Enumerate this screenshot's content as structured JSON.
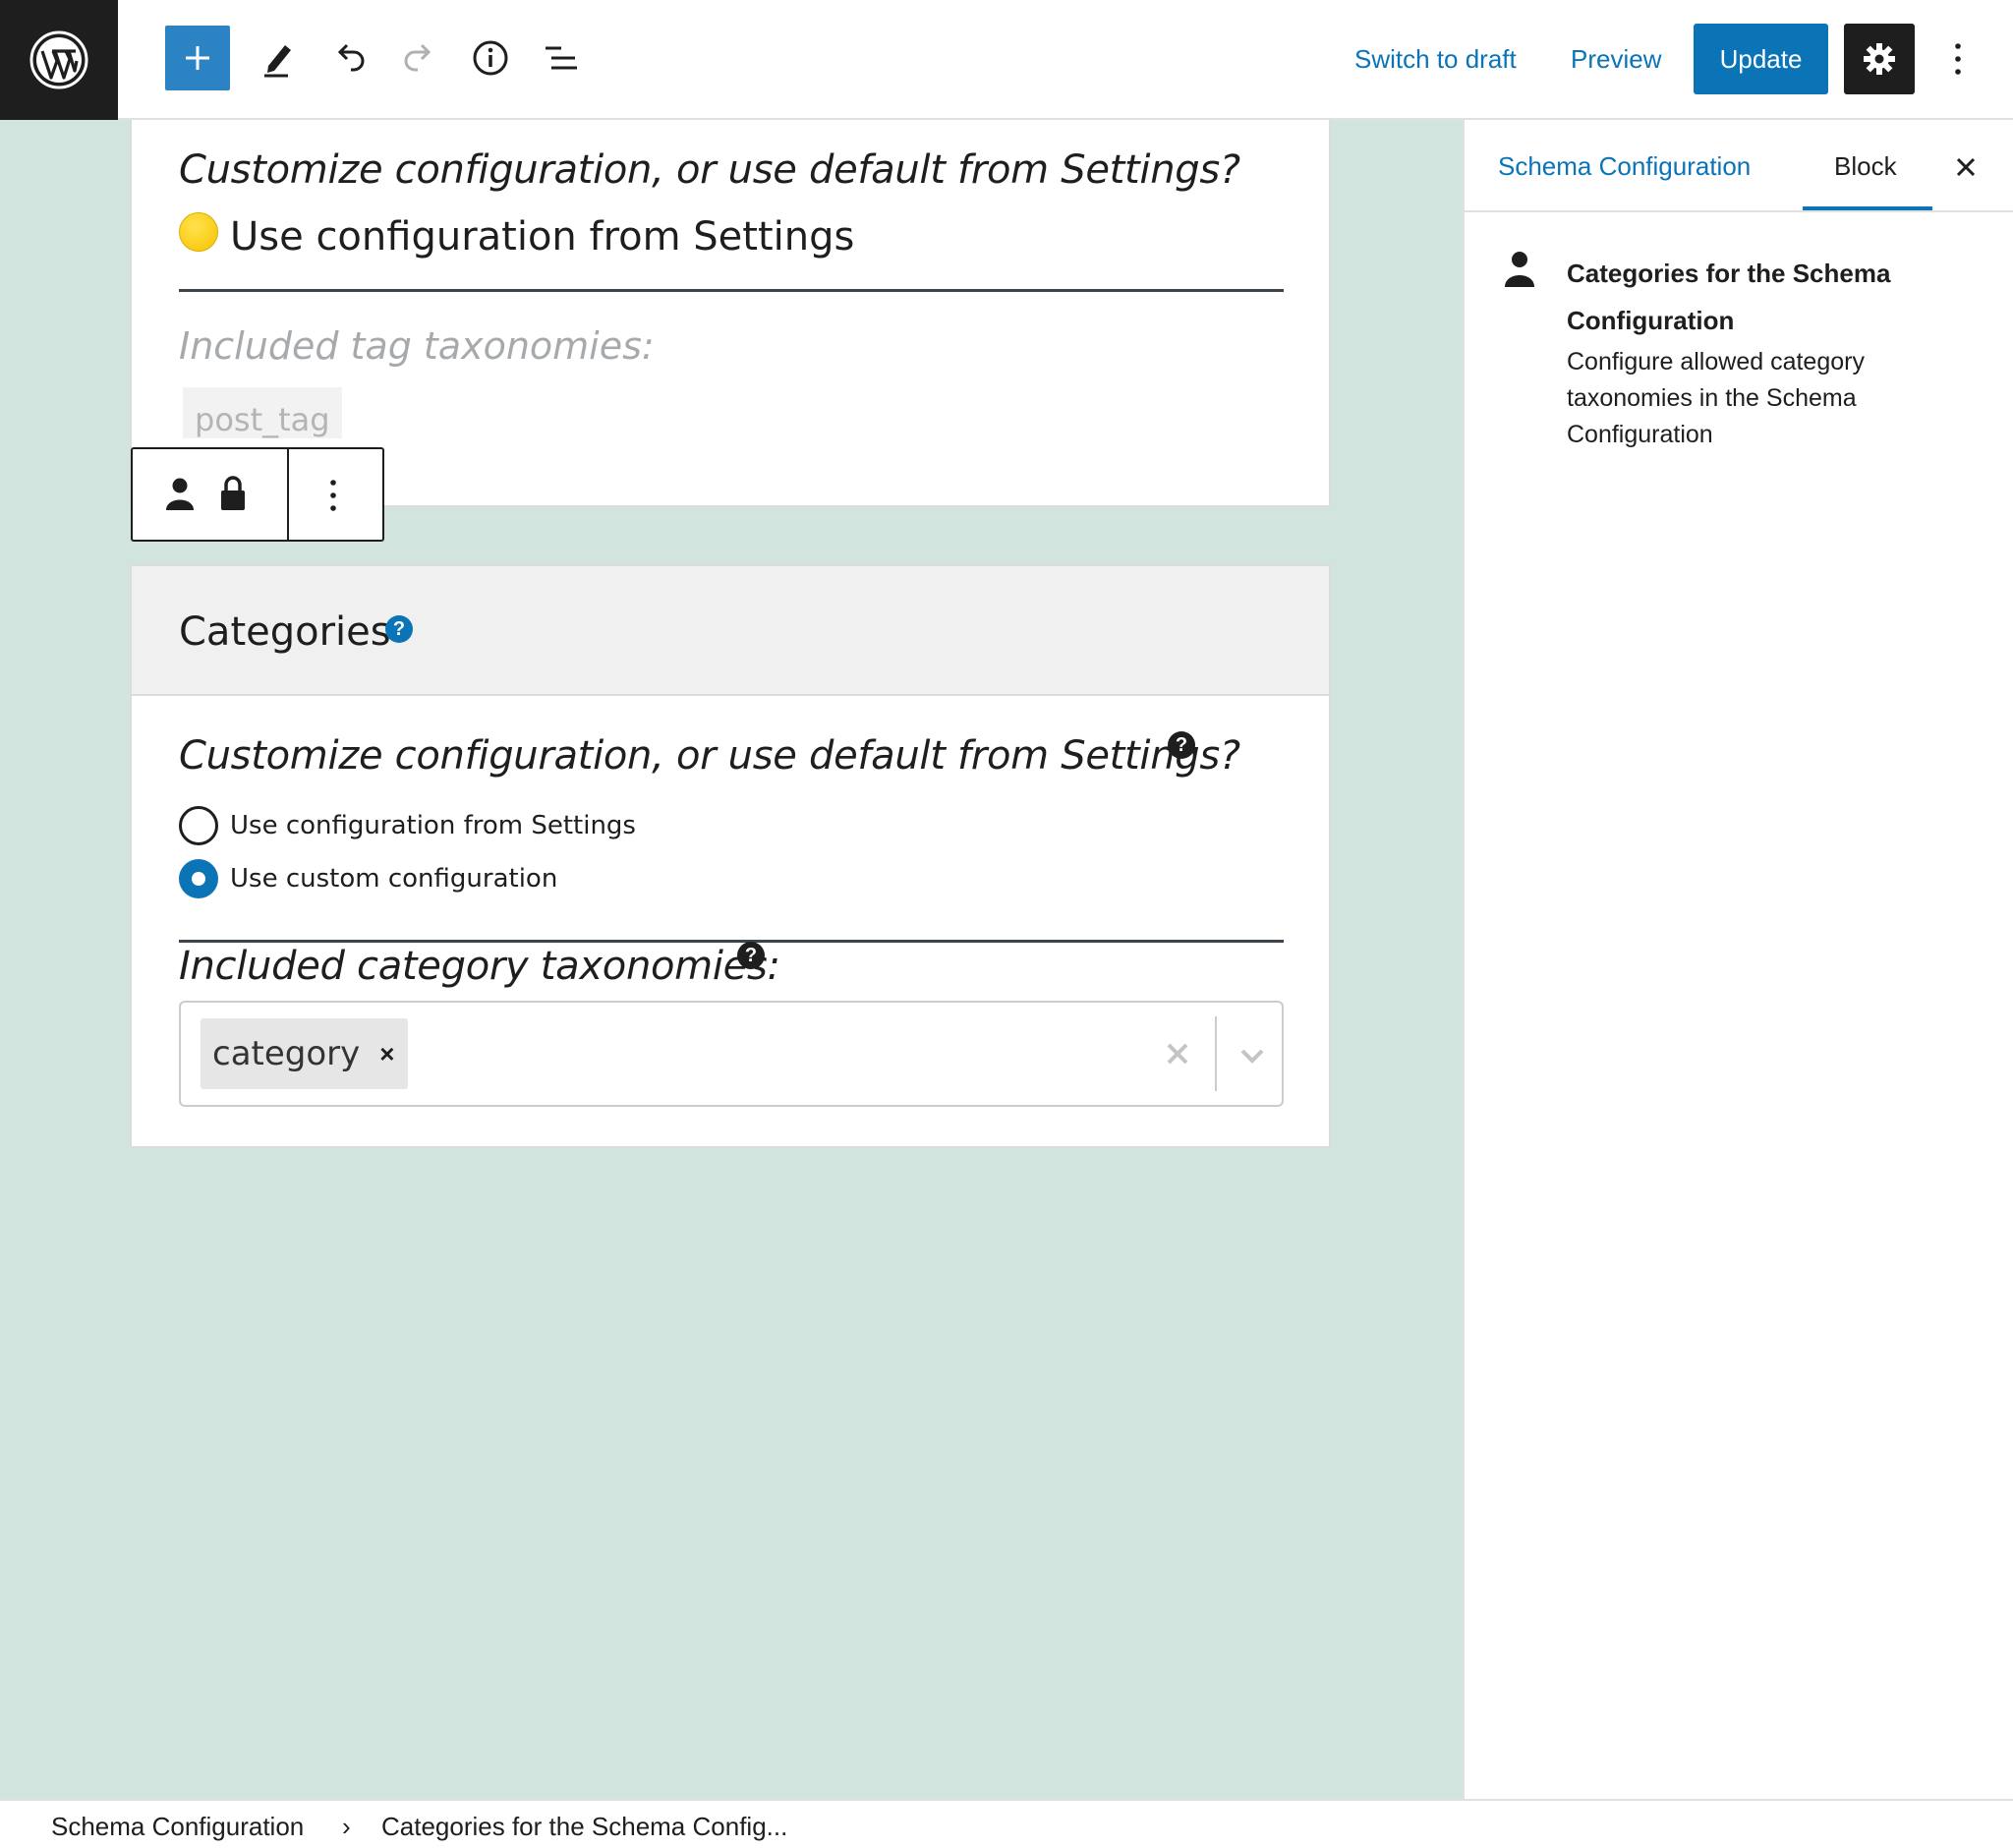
{
  "toolbar": {
    "wp_logo_icon": "wordpress-logo-icon",
    "add_block_icon": "plus-icon",
    "tools_icon": "pencil-icon",
    "undo_icon": "undo-icon",
    "redo_icon": "redo-icon",
    "details_icon": "info-icon",
    "outline_icon": "list-view-icon",
    "switch_to_draft": "Switch to draft",
    "preview": "Preview",
    "update": "Update",
    "settings_icon": "gear-icon",
    "more_icon": "vertical-ellipsis-icon",
    "accent_color": "#0a74b7"
  },
  "block_tags": {
    "question": "Customize configuration, or use default from Settings?",
    "status_emoji": "yellow-circle",
    "status_text": "Use configuration from Settings",
    "included_label": "Included tag taxonomies:",
    "included_value": "post_tag"
  },
  "block_toolbar": {
    "block_type_icon": "person-icon",
    "lock_icon": "lock-icon",
    "options_icon": "vertical-ellipsis-icon"
  },
  "block_categories": {
    "title": "Categories",
    "title_help": "?",
    "question": "Customize configuration, or use default from Settings?",
    "question_help": "?",
    "options": [
      {
        "label": "Use configuration from Settings",
        "checked": false
      },
      {
        "label": "Use custom configuration",
        "checked": true
      }
    ],
    "included_label": "Included category taxonomies:",
    "included_help": "?",
    "selected": [
      {
        "label": "category",
        "remove": "×"
      }
    ]
  },
  "sidebar": {
    "tabs": [
      {
        "label": "Schema Configuration",
        "active": false
      },
      {
        "label": "Block",
        "active": true
      }
    ],
    "close_icon": "close-icon",
    "block_icon": "person-icon",
    "block_title": "Categories for the Schema Configuration",
    "block_description": "Configure allowed category taxonomies in the Schema Configuration"
  },
  "breadcrumb": {
    "items": [
      "Schema Configuration",
      "Categories for the Schema Config..."
    ],
    "separator": "›"
  },
  "colors": {
    "canvas_bg": "#d1e4dd",
    "primary": "#0a74b7",
    "dark": "#1e1e1e"
  }
}
